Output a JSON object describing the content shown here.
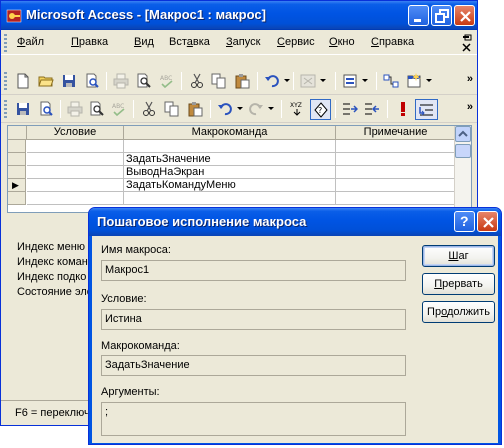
{
  "window": {
    "title": "Microsoft Access - [Макрос1 : макрос]"
  },
  "menubar": {
    "items": [
      {
        "pre": "",
        "u": "Ф",
        "post": "айл"
      },
      {
        "pre": "",
        "u": "П",
        "post": "равка"
      },
      {
        "pre": "",
        "u": "В",
        "post": "ид"
      },
      {
        "pre": "Вст",
        "u": "а",
        "post": "вка"
      },
      {
        "pre": "",
        "u": "З",
        "post": "апуск"
      },
      {
        "pre": "",
        "u": "С",
        "post": "ервис"
      },
      {
        "pre": "",
        "u": "О",
        "post": "кно"
      },
      {
        "pre": "",
        "u": "С",
        "post": "правка"
      }
    ]
  },
  "toolbar": {
    "more_glyph": "»"
  },
  "grid": {
    "headers": [
      "Условие",
      "Макрокоманда",
      "Примечание"
    ],
    "rows": [
      {
        "condition": "",
        "action": "",
        "note": ""
      },
      {
        "condition": "",
        "action": "ЗадатьЗначение",
        "note": ""
      },
      {
        "condition": "",
        "action": "ВыводНаЭкран",
        "note": ""
      },
      {
        "condition": "",
        "action": "ЗадатьКомандуМеню",
        "note": ""
      },
      {
        "condition": "",
        "action": "",
        "note": ""
      }
    ],
    "current_row_marker": "▶"
  },
  "properties": {
    "labels": [
      "Индекс меню",
      "Индекс коман,",
      "Индекс подко",
      "Состояние эле"
    ]
  },
  "status": {
    "text": "F6 = переключ"
  },
  "dialog": {
    "title": "Пошаговое исполнение макроса",
    "help_glyph": "?",
    "fields": {
      "macro_name": {
        "label": "Имя макроса:",
        "value": "Макрос1"
      },
      "condition": {
        "label": "Условие:",
        "value": "Истина"
      },
      "action": {
        "label": "Макрокоманда:",
        "value": "ЗадатьЗначение"
      },
      "arguments": {
        "label": "Аргументы:",
        "value": ";"
      }
    },
    "buttons": {
      "step": {
        "u": "Ш",
        "post": "аг"
      },
      "halt": {
        "pre": "",
        "u": "П",
        "post": "рервать"
      },
      "continue": {
        "pre": "Пр",
        "u": "о",
        "post": "должить"
      }
    }
  },
  "colors": {
    "titlebar_blue": "#0054e3",
    "face": "#ece9d8",
    "close_red": "#c83a13"
  }
}
